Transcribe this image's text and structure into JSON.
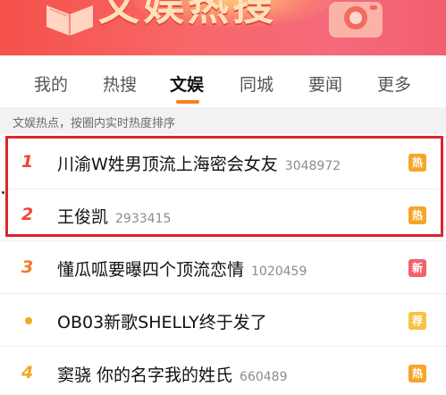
{
  "banner": {
    "title": "文娱热搜"
  },
  "tabs": [
    {
      "label": "我的"
    },
    {
      "label": "热搜"
    },
    {
      "label": "文娱"
    },
    {
      "label": "同城"
    },
    {
      "label": "要闻"
    },
    {
      "label": "更多"
    }
  ],
  "section": {
    "text": "文娱热点，按圈内实时热度排序"
  },
  "items": [
    {
      "rank": "1",
      "title": "川渝W姓男顶流上海密会女友",
      "count": "3048972",
      "badge": "热"
    },
    {
      "rank": "2",
      "title": "王俊凯",
      "count": "2933415",
      "badge": "热"
    },
    {
      "rank": "3",
      "title": "懂瓜呱要曝四个顶流恋情",
      "count": "1020459",
      "badge": "新"
    },
    {
      "rank": "",
      "title": "OB03新歌SHELLY终于发了",
      "count": "",
      "badge": "荐"
    },
    {
      "rank": "4",
      "title": "窦骁 你的名字我的姓氏",
      "count": "660489",
      "badge": "热"
    }
  ],
  "colors": {
    "accent": "#f7801c",
    "highlight": "#d9262e",
    "hot_badge": "#f7a52a",
    "new_badge": "#f4616b",
    "rec_badge": "#f8c243"
  }
}
